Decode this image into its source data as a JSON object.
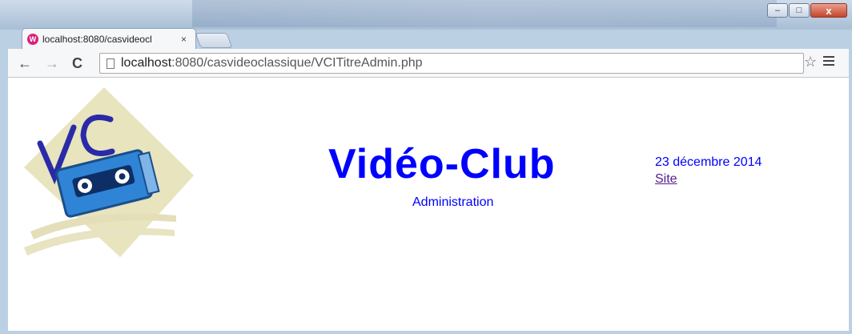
{
  "browser": {
    "tab_title": "localhost:8080/casvideocl",
    "tab_close": "×",
    "url_host": "localhost",
    "url_rest": ":8080/casvideoclassique/VCITitreAdmin.php",
    "window_controls": {
      "minimize": "–",
      "maximize": "□",
      "close": "x"
    },
    "icons": {
      "back": "back-arrow-icon",
      "forward": "forward-arrow-icon",
      "reload": "reload-icon",
      "bookmark": "star-icon",
      "menu": "hamburger-menu-icon"
    }
  },
  "page": {
    "title": "Vidéo-Club",
    "subtitle": "Administration",
    "date": "23 décembre 2014",
    "site_link": "Site"
  },
  "colors": {
    "title": "#0000ff",
    "link": "#551a8b",
    "tab_icon": "#d6247a"
  }
}
